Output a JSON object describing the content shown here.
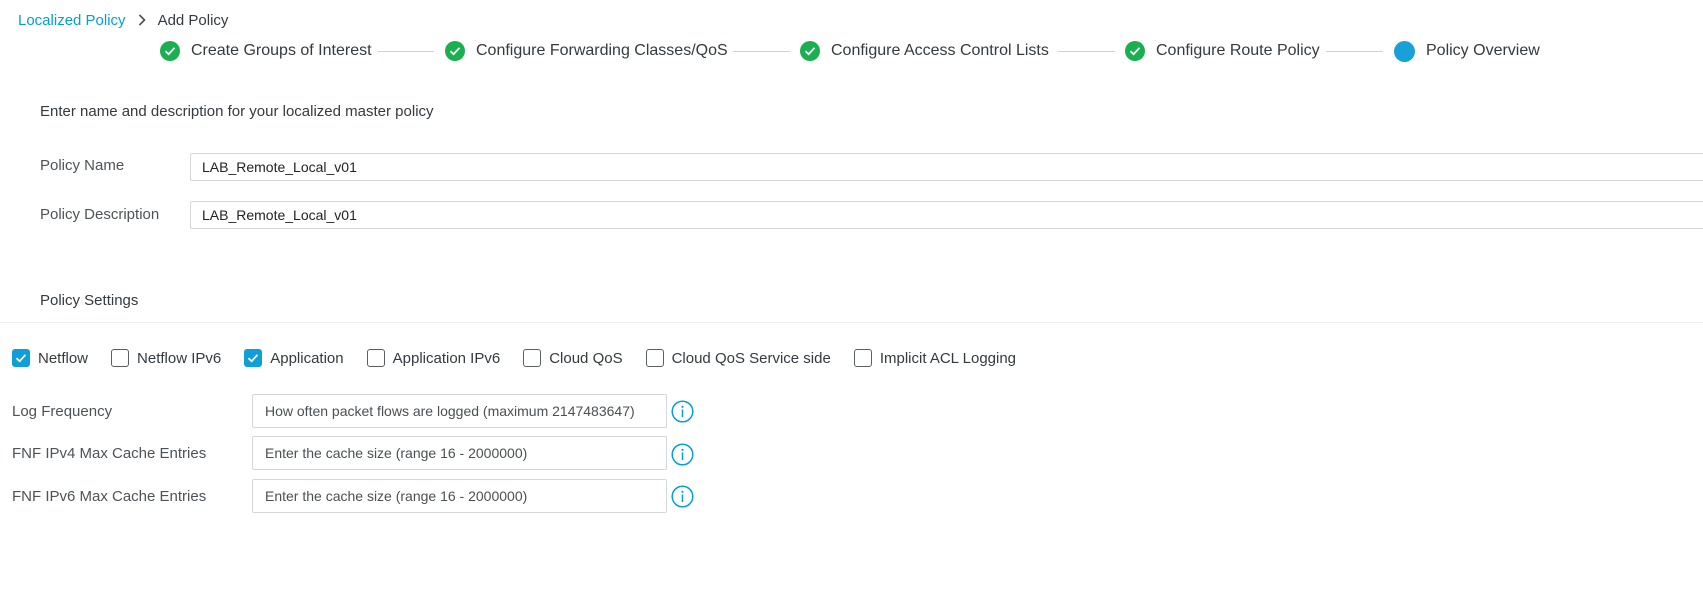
{
  "breadcrumb": {
    "parent": "Localized Policy",
    "current": "Add Policy"
  },
  "steps": [
    {
      "label": "Create Groups of Interest",
      "status": "complete"
    },
    {
      "label": "Configure Forwarding Classes/QoS",
      "status": "complete"
    },
    {
      "label": "Configure Access Control Lists",
      "status": "complete"
    },
    {
      "label": "Configure Route Policy",
      "status": "complete"
    },
    {
      "label": "Policy Overview",
      "status": "current"
    }
  ],
  "intro_text": "Enter name and description for your localized master policy",
  "policy_name": {
    "label": "Policy Name",
    "value": "LAB_Remote_Local_v01"
  },
  "policy_description": {
    "label": "Policy Description",
    "value": "LAB_Remote_Local_v01"
  },
  "settings": {
    "title": "Policy Settings",
    "checkboxes": [
      {
        "label": "Netflow",
        "checked": true
      },
      {
        "label": "Netflow IPv6",
        "checked": false
      },
      {
        "label": "Application",
        "checked": true
      },
      {
        "label": "Application IPv6",
        "checked": false
      },
      {
        "label": "Cloud QoS",
        "checked": false
      },
      {
        "label": "Cloud QoS Service side",
        "checked": false
      },
      {
        "label": "Implicit ACL Logging",
        "checked": false
      }
    ],
    "log_frequency": {
      "label": "Log Frequency",
      "placeholder": "How often packet flows are logged (maximum 2147483647)"
    },
    "fnf_ipv4": {
      "label": "FNF IPv4 Max Cache Entries",
      "placeholder": "Enter the cache size (range 16 - 2000000)"
    },
    "fnf_ipv6": {
      "label": "FNF IPv6 Max Cache Entries",
      "placeholder": "Enter the cache size (range 16 - 2000000)"
    }
  },
  "icons": {
    "breadcrumb_separator": "chevron-right-icon",
    "step_complete": "check-circle-icon",
    "step_current": "dot-circle-icon",
    "info": "info-icon"
  },
  "colors": {
    "link": "#049fd9",
    "step_complete": "#1ab050",
    "step_current": "#18a0d8",
    "checkbox_checked": "#0f9ed8",
    "info_icon": "#049fd9"
  }
}
